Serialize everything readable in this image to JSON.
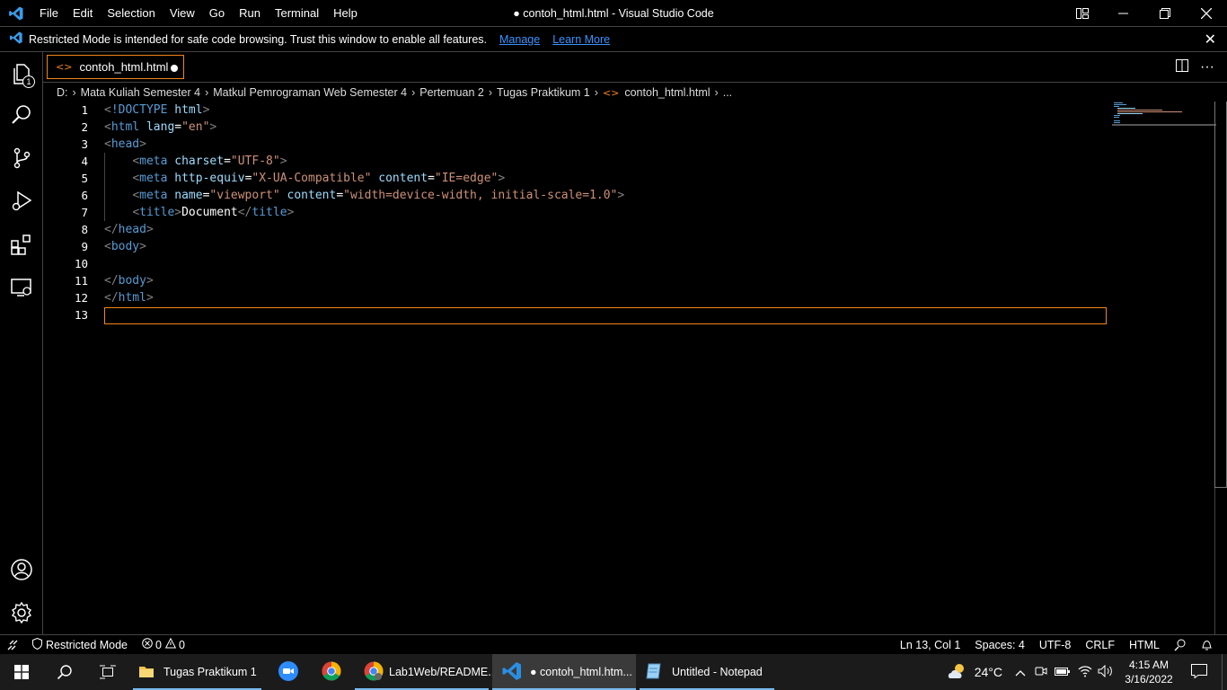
{
  "titlebar": {
    "menu": [
      "File",
      "Edit",
      "Selection",
      "View",
      "Go",
      "Run",
      "Terminal",
      "Help"
    ],
    "title": "● contoh_html.html - Visual Studio Code"
  },
  "banner": {
    "message": "Restricted Mode is intended for safe code browsing. Trust this window to enable all features.",
    "manage": "Manage",
    "learn_more": "Learn More"
  },
  "activity": {
    "explorer_badge": "1"
  },
  "tab": {
    "label": "contoh_html.html",
    "icon": "<>"
  },
  "breadcrumb": {
    "items": [
      "D:",
      "Mata Kuliah Semester 4",
      "Matkul Pemrograman Web Semester 4",
      "Pertemuan 2",
      "Tugas Praktikum 1",
      "contoh_html.html",
      "..."
    ],
    "file_icon": "<>"
  },
  "editor": {
    "line_numbers": [
      "1",
      "2",
      "3",
      "4",
      "5",
      "6",
      "7",
      "8",
      "9",
      "10",
      "11",
      "12",
      "13"
    ],
    "lines": [
      [
        {
          "c": "p",
          "t": "<"
        },
        {
          "c": "t",
          "t": "!DOCTYPE "
        },
        {
          "c": "a",
          "t": "html"
        },
        {
          "c": "p",
          "t": ">"
        }
      ],
      [
        {
          "c": "p",
          "t": "<"
        },
        {
          "c": "t",
          "t": "html "
        },
        {
          "c": "a",
          "t": "lang"
        },
        {
          "c": "x",
          "t": "="
        },
        {
          "c": "s",
          "t": "\"en\""
        },
        {
          "c": "p",
          "t": ">"
        }
      ],
      [
        {
          "c": "p",
          "t": "<"
        },
        {
          "c": "t",
          "t": "head"
        },
        {
          "c": "p",
          "t": ">"
        }
      ],
      [
        {
          "c": "x",
          "t": "    "
        },
        {
          "c": "p",
          "t": "<"
        },
        {
          "c": "t",
          "t": "meta "
        },
        {
          "c": "a",
          "t": "charset"
        },
        {
          "c": "x",
          "t": "="
        },
        {
          "c": "s",
          "t": "\"UTF-8\""
        },
        {
          "c": "p",
          "t": ">"
        }
      ],
      [
        {
          "c": "x",
          "t": "    "
        },
        {
          "c": "p",
          "t": "<"
        },
        {
          "c": "t",
          "t": "meta "
        },
        {
          "c": "a",
          "t": "http-equiv"
        },
        {
          "c": "x",
          "t": "="
        },
        {
          "c": "s",
          "t": "\"X-UA-Compatible\" "
        },
        {
          "c": "a",
          "t": "content"
        },
        {
          "c": "x",
          "t": "="
        },
        {
          "c": "s",
          "t": "\"IE=edge\""
        },
        {
          "c": "p",
          "t": ">"
        }
      ],
      [
        {
          "c": "x",
          "t": "    "
        },
        {
          "c": "p",
          "t": "<"
        },
        {
          "c": "t",
          "t": "meta "
        },
        {
          "c": "a",
          "t": "name"
        },
        {
          "c": "x",
          "t": "="
        },
        {
          "c": "s",
          "t": "\"viewport\" "
        },
        {
          "c": "a",
          "t": "content"
        },
        {
          "c": "x",
          "t": "="
        },
        {
          "c": "s",
          "t": "\"width=device-width, initial-scale=1.0\""
        },
        {
          "c": "p",
          "t": ">"
        }
      ],
      [
        {
          "c": "x",
          "t": "    "
        },
        {
          "c": "p",
          "t": "<"
        },
        {
          "c": "t",
          "t": "title"
        },
        {
          "c": "p",
          "t": ">"
        },
        {
          "c": "x",
          "t": "Document"
        },
        {
          "c": "p",
          "t": "</"
        },
        {
          "c": "t",
          "t": "title"
        },
        {
          "c": "p",
          "t": ">"
        }
      ],
      [
        {
          "c": "p",
          "t": "</"
        },
        {
          "c": "t",
          "t": "head"
        },
        {
          "c": "p",
          "t": ">"
        }
      ],
      [
        {
          "c": "p",
          "t": "<"
        },
        {
          "c": "t",
          "t": "body"
        },
        {
          "c": "p",
          "t": ">"
        }
      ],
      [],
      [
        {
          "c": "p",
          "t": "</"
        },
        {
          "c": "t",
          "t": "body"
        },
        {
          "c": "p",
          "t": ">"
        }
      ],
      [
        {
          "c": "p",
          "t": "</"
        },
        {
          "c": "t",
          "t": "html"
        },
        {
          "c": "p",
          "t": ">"
        }
      ],
      []
    ]
  },
  "statusbar": {
    "restricted": "Restricted Mode",
    "errors": "0",
    "warnings": "0",
    "position": "Ln 13, Col 1",
    "spaces": "Spaces: 4",
    "encoding": "UTF-8",
    "eol": "CRLF",
    "language": "HTML"
  },
  "taskbar": {
    "apps": [
      {
        "name": "folder",
        "label": "Tugas Praktikum 1"
      },
      {
        "name": "zoom",
        "label": ""
      },
      {
        "name": "chrome",
        "label": ""
      },
      {
        "name": "chrome-profile",
        "label": "Lab1Web/README...."
      },
      {
        "name": "vscode",
        "label": "● contoh_html.htm..."
      },
      {
        "name": "notepad",
        "label": "Untitled - Notepad"
      }
    ],
    "weather": "24°C",
    "time": "4:15 AM",
    "date": "3/16/2022"
  },
  "colors": {
    "accent": "#f38518",
    "link": "#3794ff",
    "tag": "#569cd6",
    "attr": "#9cdcfe",
    "string": "#ce9178"
  }
}
